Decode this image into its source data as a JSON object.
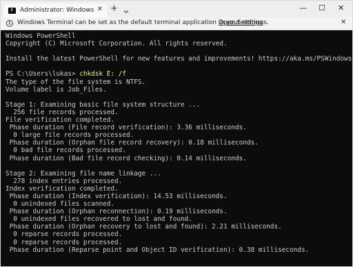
{
  "window": {
    "tab_title": "Administrator: Windows PowerS",
    "tab_close": "✕",
    "new_tab": "+",
    "dropdown_icon": "chevron-down-icon",
    "minimize": "—",
    "maximize": "☐",
    "close": "✕"
  },
  "infobar": {
    "icon": "info-icon",
    "message": "Windows Terminal can be set as the default terminal application in your settings.",
    "link": "Open Settings",
    "close": "✕"
  },
  "terminal": {
    "prompt": "PS C:\\Users\\lukas> ",
    "command": "chkdsk E: /f",
    "lines_before": [
      "Windows PowerShell",
      "Copyright (C) Microsoft Corporation. All rights reserved.",
      "",
      "Install the latest PowerShell for new features and improvements! https://aka.ms/PSWindows",
      ""
    ],
    "lines_after": [
      "The type of the file system is NTFS.",
      "Volume label is Job_Files.",
      "",
      "Stage 1: Examining basic file system structure ...",
      "  256 file records processed.",
      "File verification completed.",
      " Phase duration (File record verification): 3.36 milliseconds.",
      "  0 large file records processed.",
      " Phase duration (Orphan file record recovery): 0.18 milliseconds.",
      "  0 bad file records processed.",
      " Phase duration (Bad file record checking): 0.14 milliseconds.",
      "",
      "Stage 2: Examining file name linkage ...",
      "  278 index entries processed.",
      "Index verification completed.",
      " Phase duration (Index verification): 14.53 milliseconds.",
      "  0 unindexed files scanned.",
      " Phase duration (Orphan reconnection): 0.19 milliseconds.",
      "  0 unindexed files recovered to lost and found.",
      " Phase duration (Orphan recovery to lost and found): 2.21 milliseconds.",
      "  0 reparse records processed.",
      "  0 reparse records processed.",
      " Phase duration (Reparse point and Object ID verification): 0.38 milliseconds."
    ]
  }
}
